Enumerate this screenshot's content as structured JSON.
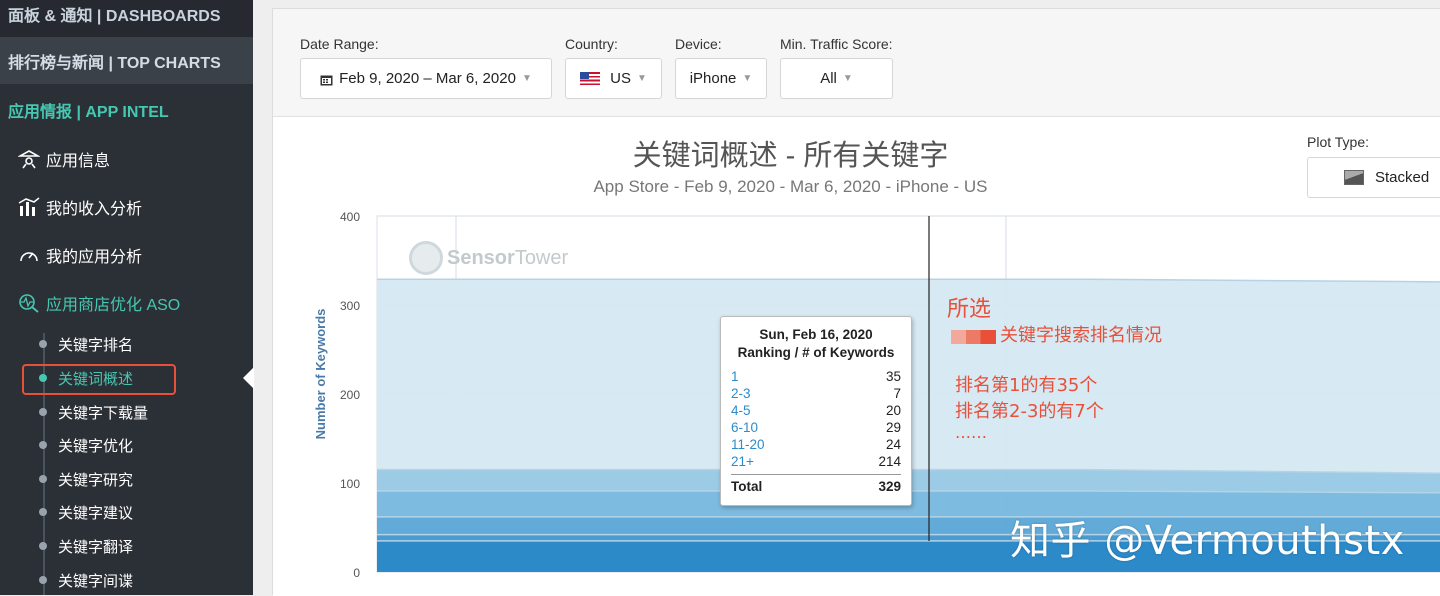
{
  "sidebar": {
    "dashboards": "面板 & 通知 | DASHBOARDS",
    "top_charts": "排行榜与新闻 | TOP CHARTS",
    "app_intel": "应用情报 | APP INTEL",
    "nav": [
      {
        "label": "应用信息",
        "icon": "app-info-icon"
      },
      {
        "label": "我的收入分析",
        "icon": "revenue-chart-icon"
      },
      {
        "label": "我的应用分析",
        "icon": "gauge-icon"
      },
      {
        "label": "应用商店优化 ASO",
        "icon": "aso-search-icon"
      }
    ],
    "aso_items": [
      "关键字排名",
      "关键词概述",
      "关键字下载量",
      "关键字优化",
      "关键字研究",
      "关键字建议",
      "关键字翻译",
      "关键字间谍"
    ],
    "active_item": "关键词概述"
  },
  "filters": {
    "date_range_label": "Date Range:",
    "date_range_value": "Feb 9, 2020 – Mar 6, 2020",
    "country_label": "Country:",
    "country_value": "US",
    "device_label": "Device:",
    "device_value": "iPhone",
    "traffic_label": "Min. Traffic Score:",
    "traffic_value": "All"
  },
  "chart": {
    "title": "关键词概述 - 所有关键字",
    "subtitle": "App Store - Feb 9, 2020 - Mar 6, 2020 - iPhone - US",
    "plot_type_label": "Plot Type:",
    "plot_type_value": "Stacked",
    "ylabel": "Number of Keywords",
    "yticks": [
      "400",
      "300",
      "200",
      "100",
      "0"
    ]
  },
  "chart_data": {
    "type": "area",
    "title": "关键词概述 - 所有关键字",
    "subtitle": "App Store - Feb 9, 2020 - Mar 6, 2020 - iPhone - US",
    "xlabel": "",
    "ylabel": "Number of Keywords",
    "ylim": [
      0,
      400
    ],
    "stacked": true,
    "series": [
      {
        "name": "1",
        "values": [
          35,
          35,
          35,
          35
        ]
      },
      {
        "name": "2-3",
        "values": [
          7,
          7,
          7,
          7
        ]
      },
      {
        "name": "4-5",
        "values": [
          20,
          20,
          20,
          20
        ]
      },
      {
        "name": "6-10",
        "values": [
          29,
          29,
          29,
          27
        ]
      },
      {
        "name": "11-20",
        "values": [
          24,
          24,
          24,
          22
        ]
      },
      {
        "name": "21+",
        "values": [
          214,
          214,
          214,
          215
        ]
      }
    ],
    "colors": [
      "#2184c6",
      "#3f96cf",
      "#5aa6d7",
      "#77b7de",
      "#97c8e5",
      "#d5e8f1"
    ],
    "grid": true,
    "legend": "none"
  },
  "tooltip": {
    "date": "Sun, Feb 16, 2020",
    "header": "Ranking / # of Keywords",
    "rows": [
      {
        "k": "1",
        "v": "35"
      },
      {
        "k": "2-3",
        "v": "7"
      },
      {
        "k": "4-5",
        "v": "20"
      },
      {
        "k": "6-10",
        "v": "29"
      },
      {
        "k": "11-20",
        "v": "24"
      },
      {
        "k": "21+",
        "v": "214"
      }
    ],
    "total_label": "Total",
    "total_value": "329"
  },
  "annotations": {
    "selected": "所选",
    "legend_note": "关键字搜索排名情况",
    "line1": "排名第1的有35个",
    "line2": "排名第2-3的有7个",
    "line3": "……"
  },
  "watermark": "知乎 @Vermouthstx",
  "logo": {
    "part1": "Sensor",
    "part2": "Tower"
  }
}
